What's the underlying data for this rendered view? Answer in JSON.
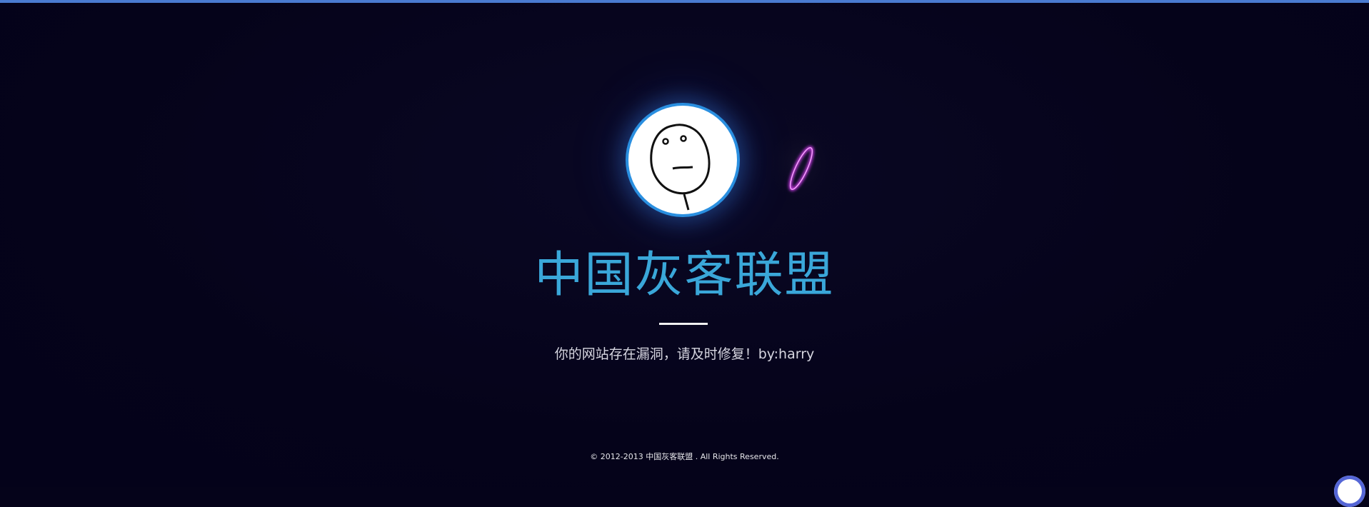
{
  "brand": {
    "title": "中国灰客联盟",
    "subtitle": "你的网站存在漏洞，请及时修复！by:harry"
  },
  "footer": {
    "copyright": "© 2012-2013 中国灰客联盟 . All Rights Reserved."
  },
  "avatar": {
    "icon": "meme-face-icon",
    "ring_color": "#2a8fe0"
  },
  "colors": {
    "background": "#05031a",
    "accent": "#3aa7d9",
    "top_bar": "#4a7bd1",
    "glow_pink": "#e040fb"
  }
}
